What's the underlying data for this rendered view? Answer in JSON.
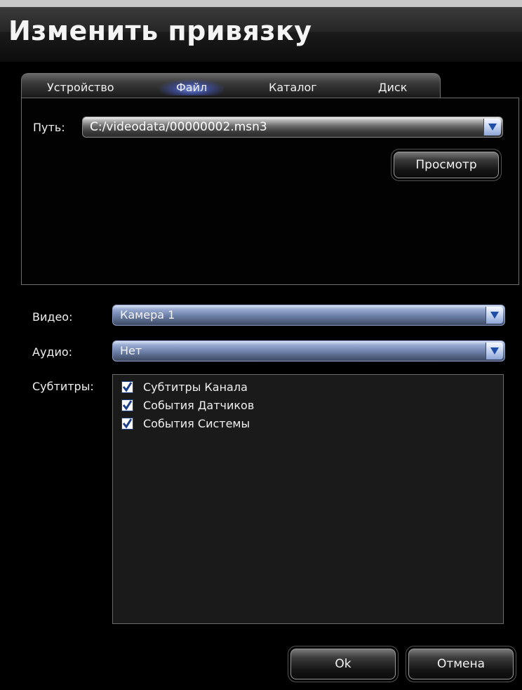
{
  "window": {
    "title": "Изменить привязку"
  },
  "tabs": [
    {
      "label": "Устройство",
      "active": false
    },
    {
      "label": "Файл",
      "active": true
    },
    {
      "label": "Каталог",
      "active": false
    },
    {
      "label": "Диск",
      "active": false
    }
  ],
  "file_tab": {
    "path_label": "Путь:",
    "path_value": "C:/videodata/00000002.msn3",
    "browse_button": "Просмотр"
  },
  "video": {
    "label": "Видео:",
    "value": "Камера 1"
  },
  "audio": {
    "label": "Аудио:",
    "value": "Нет"
  },
  "subtitles": {
    "label": "Субтитры:",
    "items": [
      {
        "label": "Субтитры Канала",
        "checked": true
      },
      {
        "label": "События Датчиков",
        "checked": true
      },
      {
        "label": "События Системы",
        "checked": true
      }
    ]
  },
  "footer": {
    "ok_label": "Ok",
    "cancel_label": "Отмена"
  },
  "colors": {
    "accent_tab_glow": "#6f8cff",
    "checkbox_mark": "#1c3f8a",
    "background": "#000000"
  }
}
